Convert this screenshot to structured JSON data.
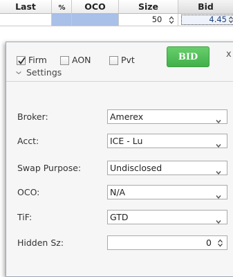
{
  "grid": {
    "headers": {
      "last": "Last",
      "pct": "%",
      "oco": "OCO",
      "size": "Size",
      "bid": "Bid"
    },
    "size_value": "50",
    "bid_value": "4.45"
  },
  "panel": {
    "firm_label": "Firm",
    "aon_label": "AON",
    "pvt_label": "Pvt",
    "firm_checked": true,
    "aon_checked": false,
    "pvt_checked": false,
    "bid_button": "BID",
    "close": "x",
    "settings_label": "Settings",
    "fields": {
      "broker_label": "Broker:",
      "broker_value": "Amerex",
      "acct_label": "Acct:",
      "acct_value": "ICE - Lu",
      "swap_label": "Swap Purpose:",
      "swap_value": "Undisclosed",
      "oco_label": "OCO:",
      "oco_value": "N/A",
      "tif_label": "TiF:",
      "tif_value": "GTD",
      "hidden_label": "Hidden Sz:",
      "hidden_value": "0"
    }
  },
  "colors": {
    "bid_button": "#4cbb52",
    "selected_cell": "#a9c0e8"
  }
}
